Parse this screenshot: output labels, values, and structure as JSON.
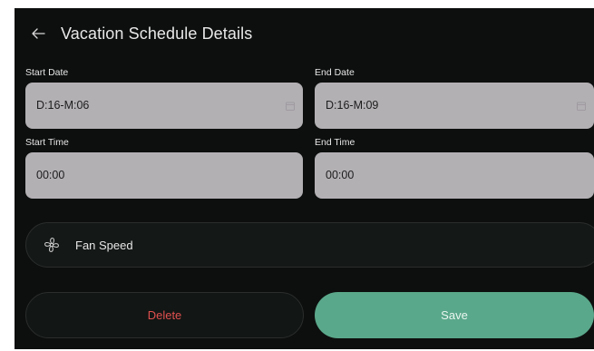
{
  "header": {
    "title": "Vacation Schedule Details"
  },
  "fields": {
    "start_date": {
      "label": "Start Date",
      "value": "D:16-M:06"
    },
    "end_date": {
      "label": "End Date",
      "value": "D:16-M:09"
    },
    "start_time": {
      "label": "Start Time",
      "value": "00:00"
    },
    "end_time": {
      "label": "End Time",
      "value": "00:00"
    }
  },
  "fan": {
    "label": "Fan Speed"
  },
  "actions": {
    "delete_label": "Delete",
    "save_label": "Save"
  },
  "colors": {
    "background": "#0d0f0e",
    "field_bg": "#b3b0b4",
    "save_green": "#5aa88b",
    "delete_red": "#e0504f"
  },
  "icons": [
    "back-arrow-icon",
    "calendar-icon",
    "fan-icon"
  ]
}
